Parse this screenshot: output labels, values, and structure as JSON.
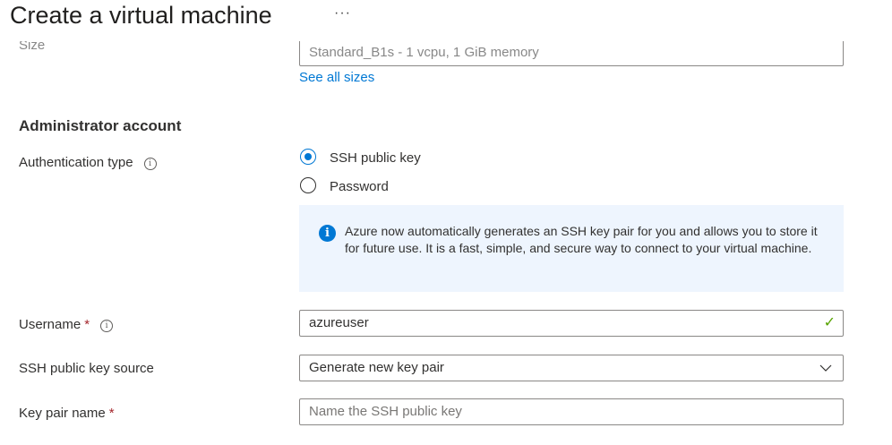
{
  "header": {
    "title": "Create a virtual machine",
    "more": "···"
  },
  "size": {
    "label": "Size",
    "value": "Standard_B1s - 1 vcpu, 1 GiB memory",
    "see_all": "See all sizes"
  },
  "admin": {
    "heading": "Administrator account",
    "auth_label": "Authentication type",
    "auth_options": [
      "SSH public key",
      "Password"
    ],
    "info_text": "Azure now automatically generates an SSH key pair for you and allows you to store it for future use. It is a fast, simple, and secure way to connect to your virtual machine.",
    "username_label": "Username",
    "username_value": "azureuser",
    "ssh_source_label": "SSH public key source",
    "ssh_source_value": "Generate new key pair",
    "key_pair_label": "Key pair name",
    "key_pair_placeholder": "Name the SSH public key",
    "required": "*"
  },
  "colors": {
    "accent": "#0078d4",
    "success": "#57a300"
  }
}
